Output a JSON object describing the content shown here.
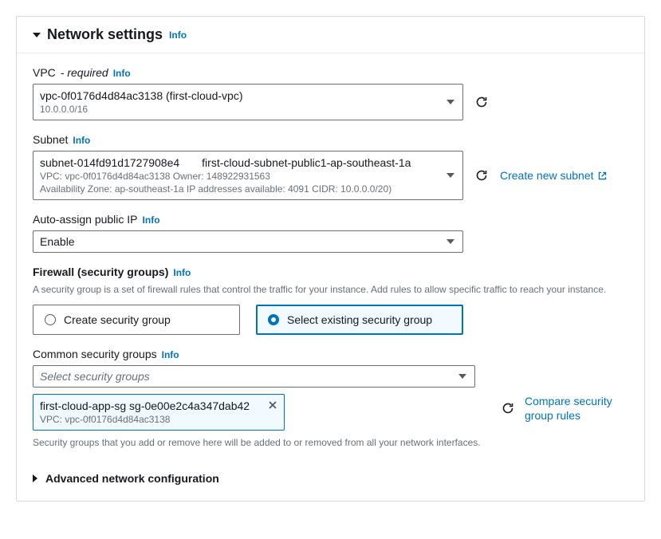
{
  "header": {
    "title": "Network settings",
    "info": "Info"
  },
  "vpc": {
    "label": "VPC",
    "required": "- required",
    "info": "Info",
    "value": "vpc-0f0176d4d84ac3138 (first-cloud-vpc)",
    "cidr": "10.0.0.0/16"
  },
  "subnet": {
    "label": "Subnet",
    "info": "Info",
    "id": "subnet-014fd91d1727908e4",
    "name": "first-cloud-subnet-public1-ap-southeast-1a",
    "line2": "VPC: vpc-0f0176d4d84ac3138    Owner: 148922931563",
    "line3": "Availability Zone: ap-southeast-1a    IP addresses available: 4091    CIDR: 10.0.0.0/20)",
    "create_link": "Create new subnet"
  },
  "auto_ip": {
    "label": "Auto-assign public IP",
    "info": "Info",
    "value": "Enable"
  },
  "firewall": {
    "label": "Firewall (security groups)",
    "info": "Info",
    "desc": "A security group is a set of firewall rules that control the traffic for your instance. Add rules to allow specific traffic to reach your instance.",
    "opt_create": "Create security group",
    "opt_select": "Select existing security group"
  },
  "common_sg": {
    "label": "Common security groups",
    "info": "Info",
    "placeholder": "Select security groups",
    "token_main": "first-cloud-app-sg   sg-0e00e2c4a347dab42",
    "token_sub": "VPC: vpc-0f0176d4d84ac3138",
    "compare_link": "Compare security group rules",
    "helper": "Security groups that you add or remove here will be added to or removed from all your network interfaces."
  },
  "advanced": {
    "label": "Advanced network configuration"
  }
}
